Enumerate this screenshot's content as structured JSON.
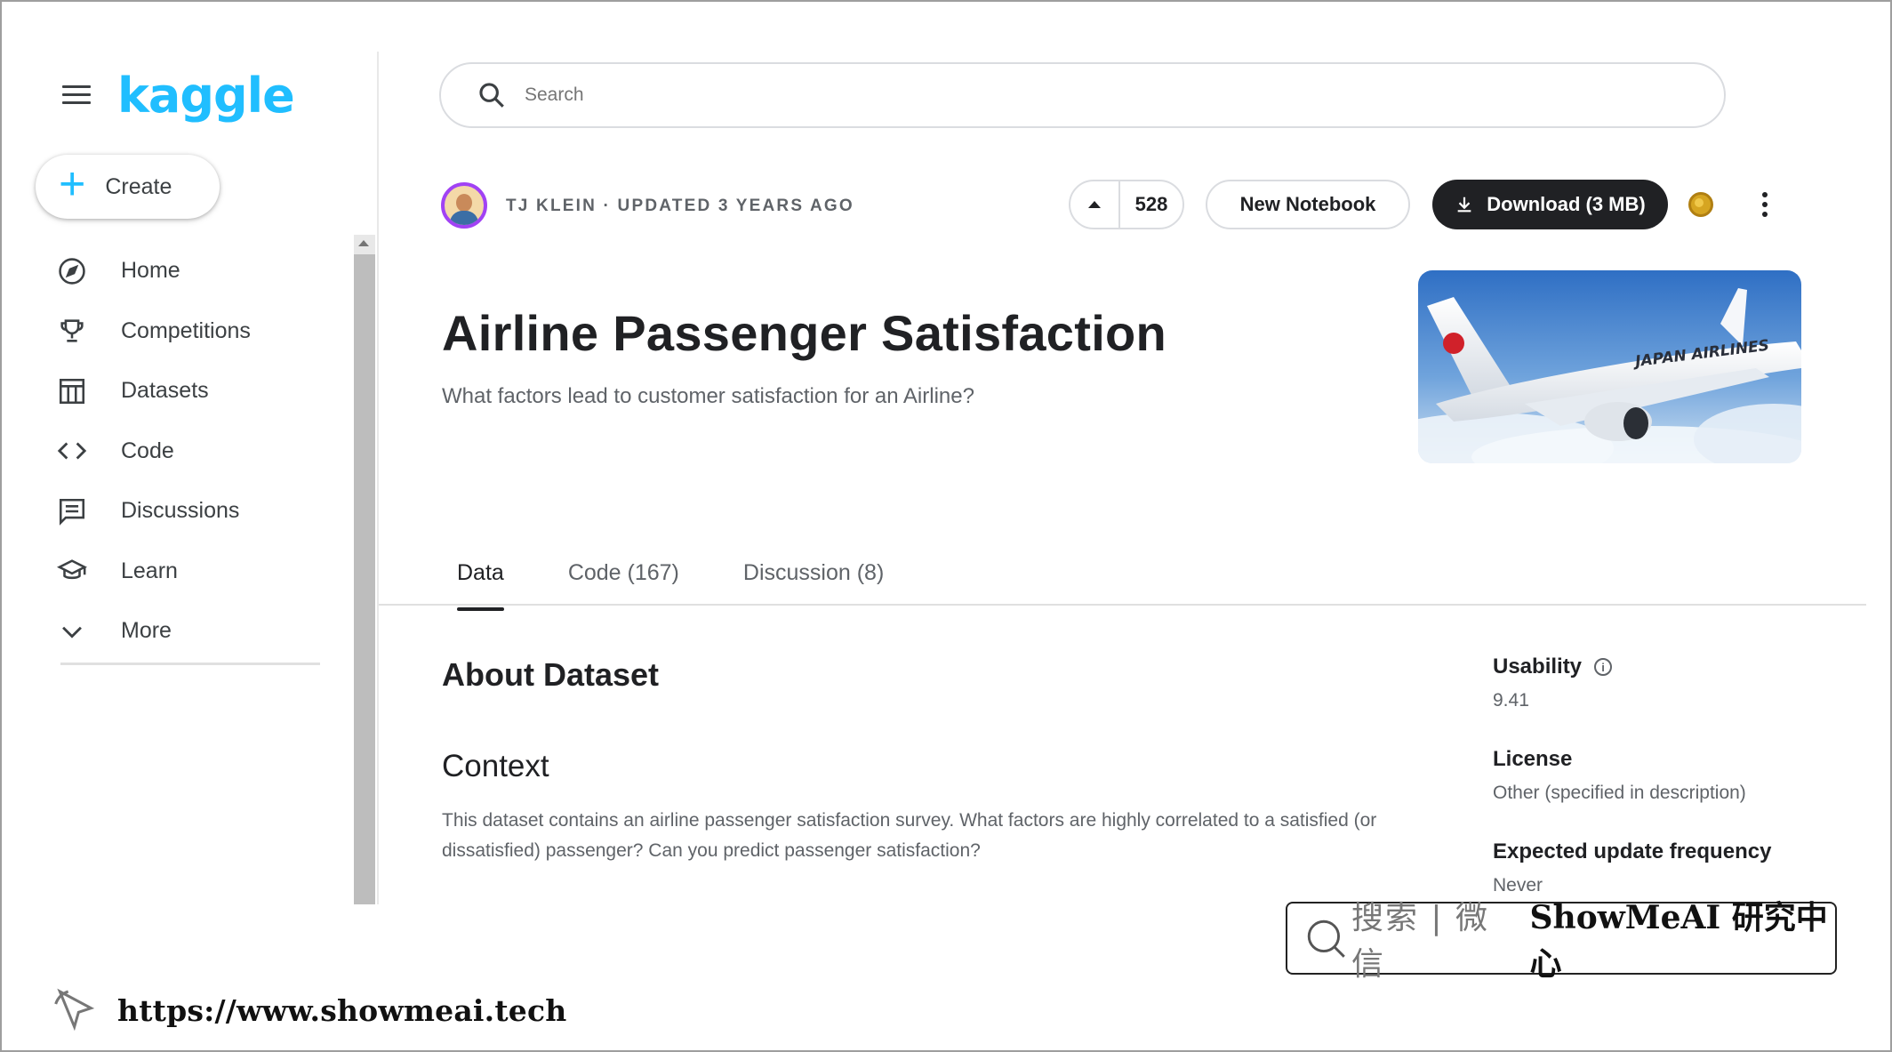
{
  "sidebar": {
    "logo": "kaggle",
    "create_label": "Create",
    "items": [
      {
        "label": "Home",
        "icon": "compass-icon"
      },
      {
        "label": "Competitions",
        "icon": "trophy-icon"
      },
      {
        "label": "Datasets",
        "icon": "table-icon"
      },
      {
        "label": "Code",
        "icon": "code-icon"
      },
      {
        "label": "Discussions",
        "icon": "discussion-icon"
      },
      {
        "label": "Learn",
        "icon": "graduation-cap-icon"
      },
      {
        "label": "More",
        "icon": "chevron-down-icon"
      }
    ]
  },
  "search": {
    "placeholder": "Search"
  },
  "dataset": {
    "owner_meta": "TJ KLEIN · UPDATED 3 YEARS AGO",
    "upvotes": "528",
    "new_notebook_label": "New Notebook",
    "download_label": "Download (3 MB)",
    "title": "Airline Passenger Satisfaction",
    "subtitle": "What factors lead to customer satisfaction for an Airline?",
    "hero_airline_text": "JAPAN AIRLINES"
  },
  "tabs": [
    {
      "label": "Data",
      "active": true
    },
    {
      "label": "Code (167)",
      "active": false
    },
    {
      "label": "Discussion (8)",
      "active": false
    }
  ],
  "content": {
    "about_heading": "About Dataset",
    "context_heading": "Context",
    "context_text": "This dataset contains an airline passenger satisfaction survey. What factors are highly correlated to a satisfied (or dissatisfied) passenger? Can you predict passenger satisfaction?"
  },
  "metadata": {
    "usability_label": "Usability",
    "usability_value": "9.41",
    "license_label": "License",
    "license_value": "Other (specified in description)",
    "frequency_label": "Expected update frequency",
    "frequency_value": "Never"
  },
  "watermark": {
    "search_text": "搜索 | 微信",
    "brand_text": "ShowMeAI 研究中心",
    "url": "https://www.showmeai.tech"
  },
  "colors": {
    "brand": "#20beff",
    "dark_button": "#202124",
    "avatar_ring": "#a142f4",
    "medal": "#d6a521"
  }
}
